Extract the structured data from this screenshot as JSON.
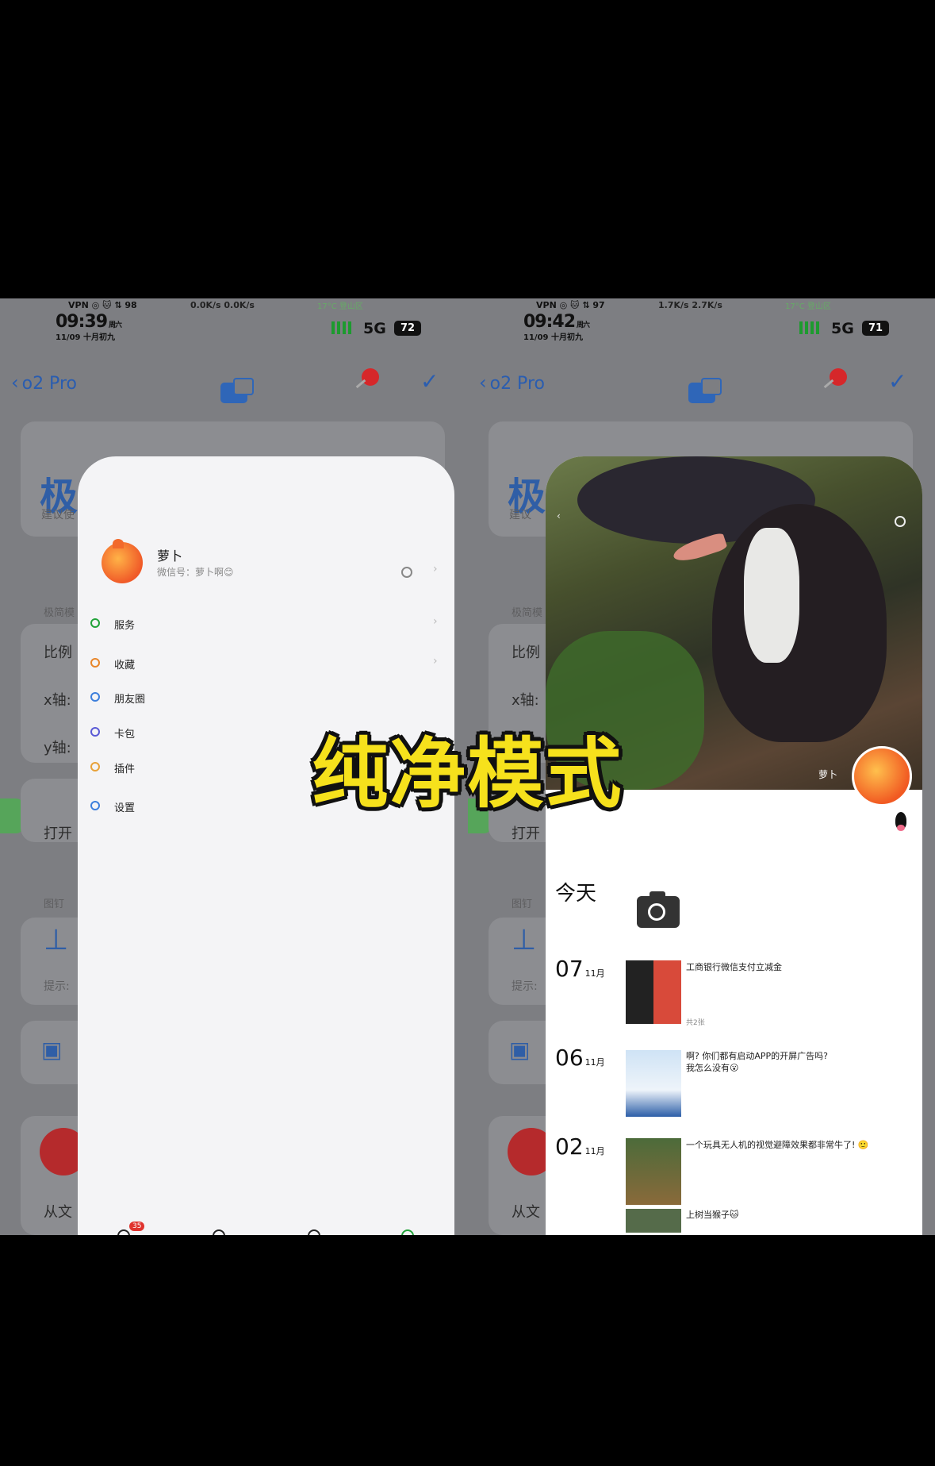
{
  "caption": "纯净模式",
  "left": {
    "status": {
      "time": "09:39",
      "weekday": "周六",
      "date": "11/09 十月初九",
      "icons": "VPN ◎ 🐱 ⇅ 98",
      "net": "0.0K/s 0.0K/s",
      "weather": "17°C 登山区",
      "network": "5G",
      "battery": "72"
    },
    "nav": {
      "back_label": "o2 Pro"
    },
    "background": {
      "big_title": "极",
      "hint": "建议使",
      "section1": "极简模",
      "row_ratio": "比例",
      "row_x": "x轴:",
      "row_y": "y轴:",
      "open_label": "打开",
      "pin_section": "图钉",
      "tip": "提示:",
      "from_file": "从文"
    },
    "profile": {
      "name": "萝卜",
      "wechat_id": "微信号：萝卜啊😊"
    },
    "menu": [
      {
        "label": "服务",
        "color": "#22a33a"
      },
      {
        "label": "收藏",
        "color": "#e8862a"
      },
      {
        "label": "朋友圈",
        "color": "#3d7fdc"
      },
      {
        "label": "卡包",
        "color": "#5a5ad6"
      },
      {
        "label": "插件",
        "color": "#e8a23a"
      },
      {
        "label": "设置",
        "color": "#3d7fdc"
      }
    ],
    "tabbar": {
      "badge": "35"
    }
  },
  "right": {
    "status": {
      "time": "09:42",
      "weekday": "周六",
      "date": "11/09 十月初九",
      "icons": "VPN ◎ 🐱 ⇅ 97",
      "net": "1.7K/s 2.7K/s",
      "weather": "17°C 登山区",
      "network": "5G",
      "battery": "71"
    },
    "nav": {
      "back_label": "o2 Pro"
    },
    "background": {
      "big_title": "极",
      "hint": "建议",
      "section1": "极简模",
      "row_ratio": "比例",
      "row_x": "x轴:",
      "row_y": "y轴:",
      "open_label": "打开",
      "pin_section": "图钉",
      "tip": "提示:",
      "from_file": "从文"
    },
    "cover_name": "萝卜",
    "today": "今天",
    "posts": [
      {
        "day": "07",
        "month": "11月",
        "text": "工商银行微信支付立减金",
        "count": "共2张"
      },
      {
        "day": "06",
        "month": "11月",
        "text": "啊? 你们都有启动APP的开屏广告吗?\n我怎么没有😮",
        "count": ""
      },
      {
        "day": "02",
        "month": "11月",
        "text": "一个玩具无人机的视觉避障效果都非常牛了! 🙂",
        "count": ""
      }
    ],
    "extra_post": "上树当猴子🐱"
  }
}
